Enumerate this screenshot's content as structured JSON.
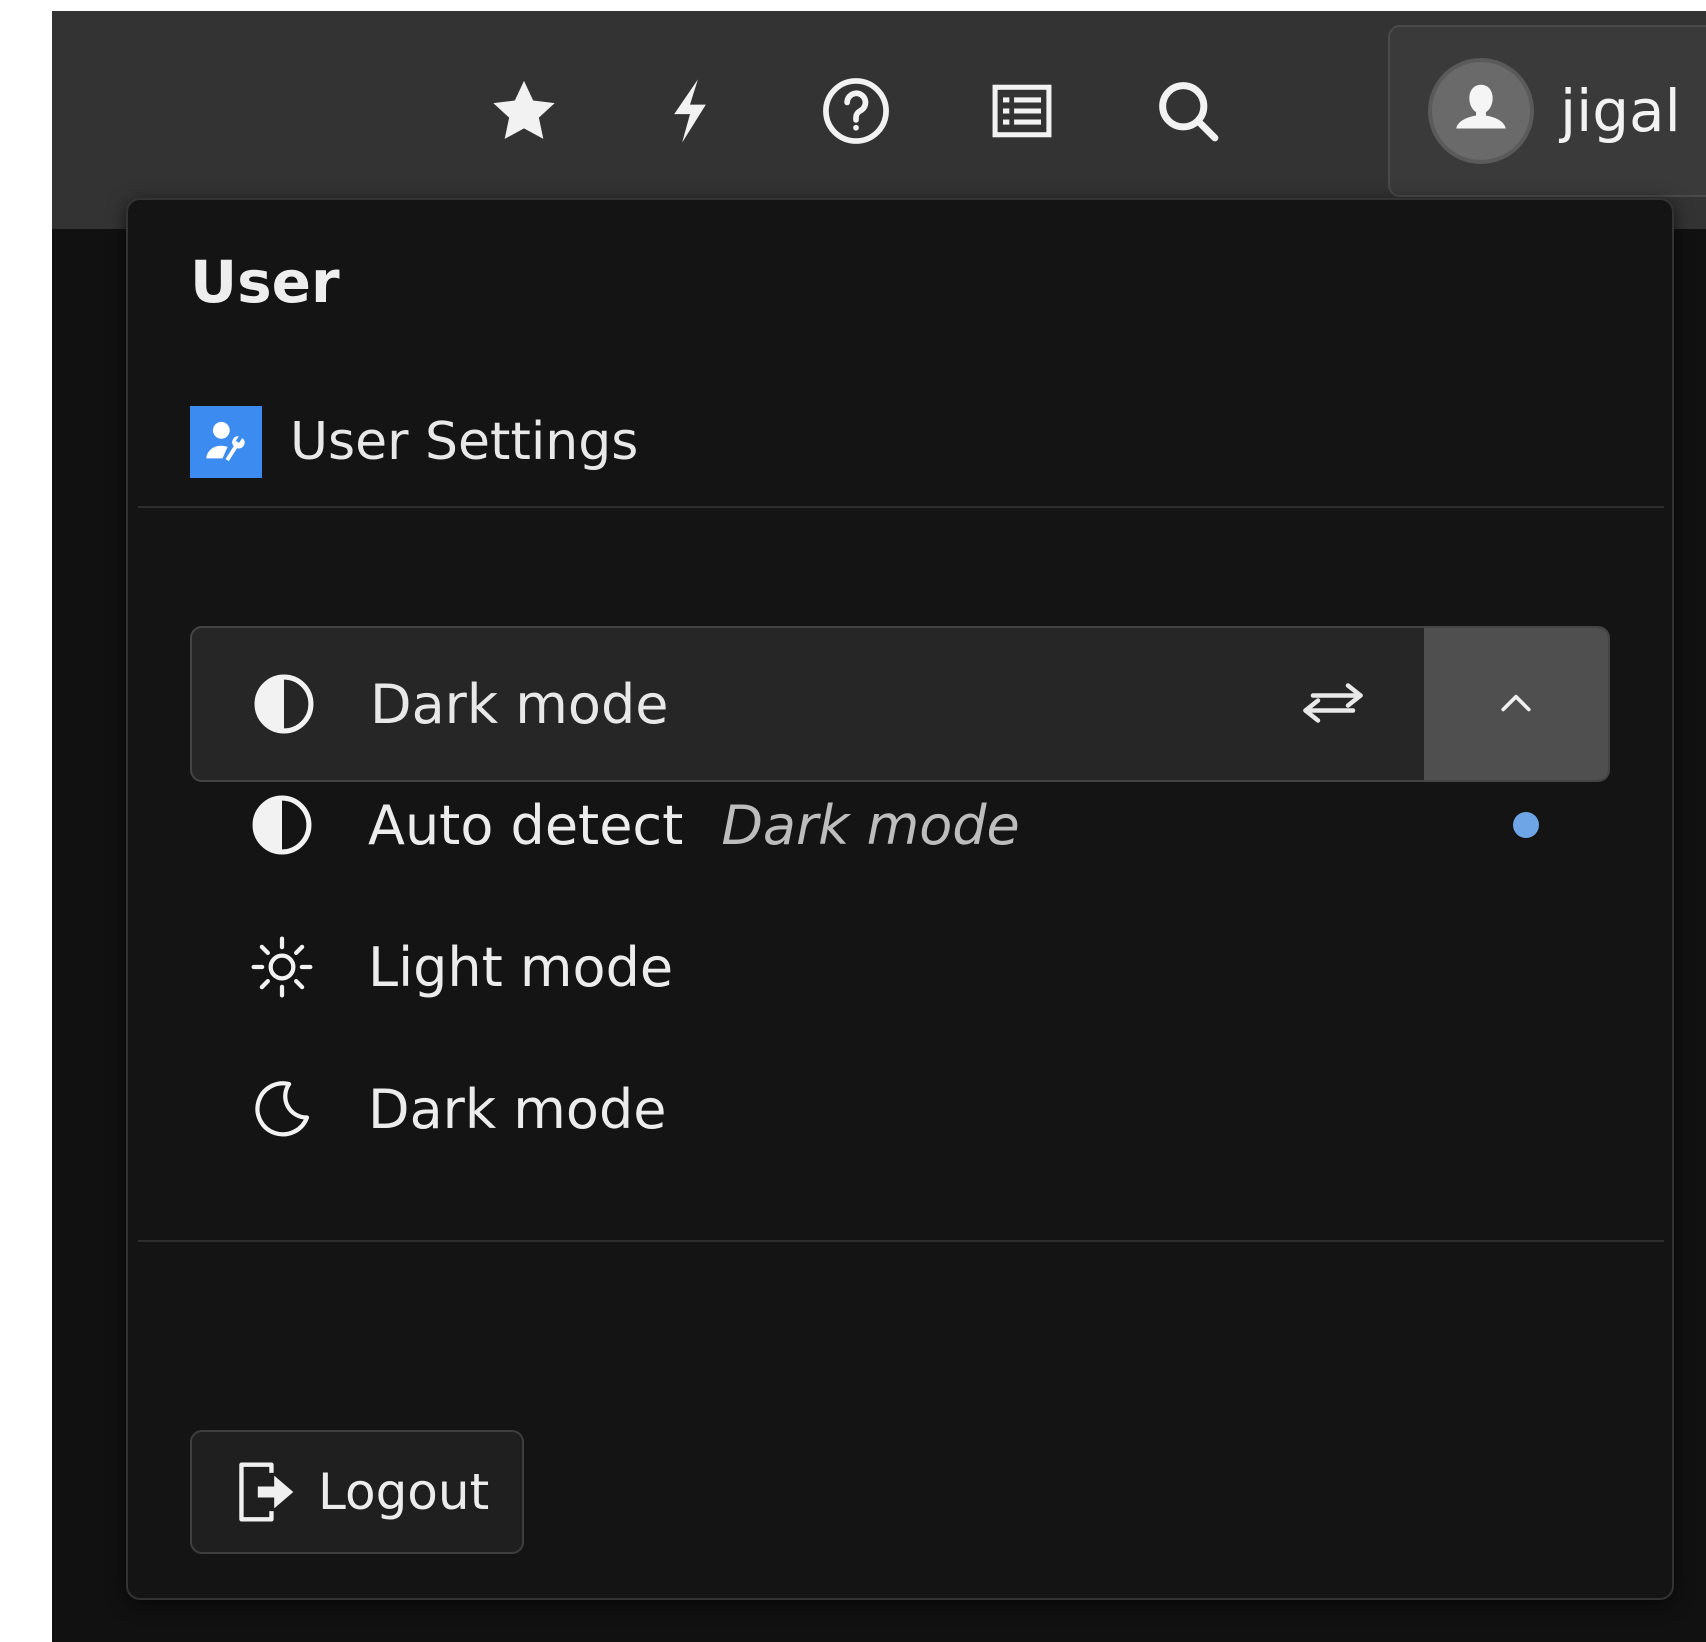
{
  "topbar": {
    "icons": [
      "star-icon",
      "bolt-icon",
      "help-icon",
      "list-icon",
      "search-icon"
    ],
    "user": {
      "name": "jigal",
      "avatar": "user-avatar-icon"
    }
  },
  "menu": {
    "title": "User",
    "settings_link": {
      "label": "User Settings",
      "icon": "user-settings-icon",
      "icon_color": "#3b8bf0"
    },
    "theme": {
      "current_label": "Dark mode",
      "current_icon": "contrast-icon",
      "swap_icon": "swap-arrows-icon",
      "toggle_icon": "chevron-up-icon",
      "options": [
        {
          "label": "Auto detect",
          "hint": "Dark mode",
          "icon": "contrast-icon",
          "selected": true
        },
        {
          "label": "Light mode",
          "icon": "sun-icon",
          "selected": false
        },
        {
          "label": "Dark mode",
          "icon": "moon-icon",
          "selected": false
        }
      ],
      "selected_indicator_color": "#6ea5e6"
    },
    "logout_label": "Logout"
  },
  "colors": {
    "topbar_bg": "#333333",
    "panel_bg": "#141414",
    "accent": "#3b8bf0"
  }
}
